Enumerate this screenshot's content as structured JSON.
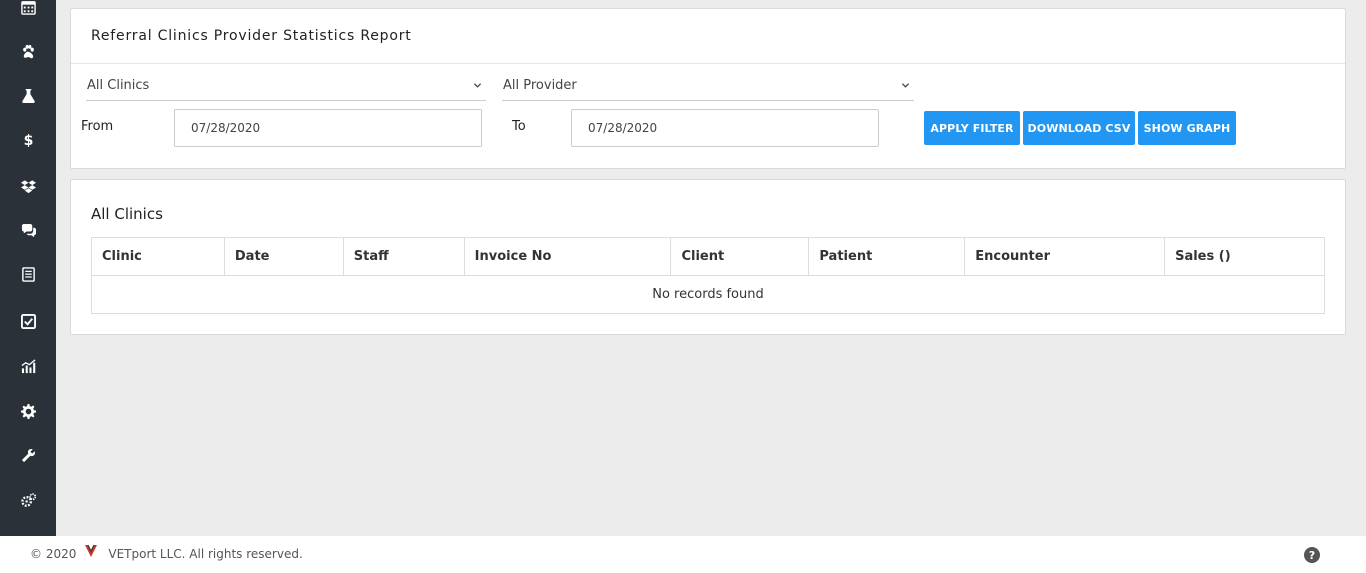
{
  "sidebar": {
    "icons": [
      "calendar-icon",
      "paw-icon",
      "flask-icon",
      "dollar-icon",
      "dropbox-icon",
      "chat-icon",
      "list-icon",
      "checkbox-icon",
      "chart-icon",
      "gear-icon",
      "wrench-icon",
      "gears-icon"
    ]
  },
  "report": {
    "title": "Referral Clinics Provider Statistics Report"
  },
  "filters": {
    "clinic_select": "All Clinics",
    "provider_select": "All Provider",
    "from_label": "From",
    "from_value": "07/28/2020",
    "to_label": "To",
    "to_value": "07/28/2020"
  },
  "buttons": {
    "apply": "APPLY FILTER",
    "download": "DOWNLOAD CSV",
    "graph": "SHOW GRAPH"
  },
  "results": {
    "section_title": "All Clinics",
    "columns": [
      "Clinic",
      "Date",
      "Staff",
      "Invoice No",
      "Client",
      "Patient",
      "Encounter",
      "Sales ()"
    ],
    "empty_message": "No records found"
  },
  "footer": {
    "copyright": "© 2020",
    "company": "VETport LLC. All rights reserved.",
    "help_label": "?"
  },
  "colors": {
    "sidebar_bg": "#2a3139",
    "accent": "#2196f3",
    "page_bg": "#ececec"
  }
}
